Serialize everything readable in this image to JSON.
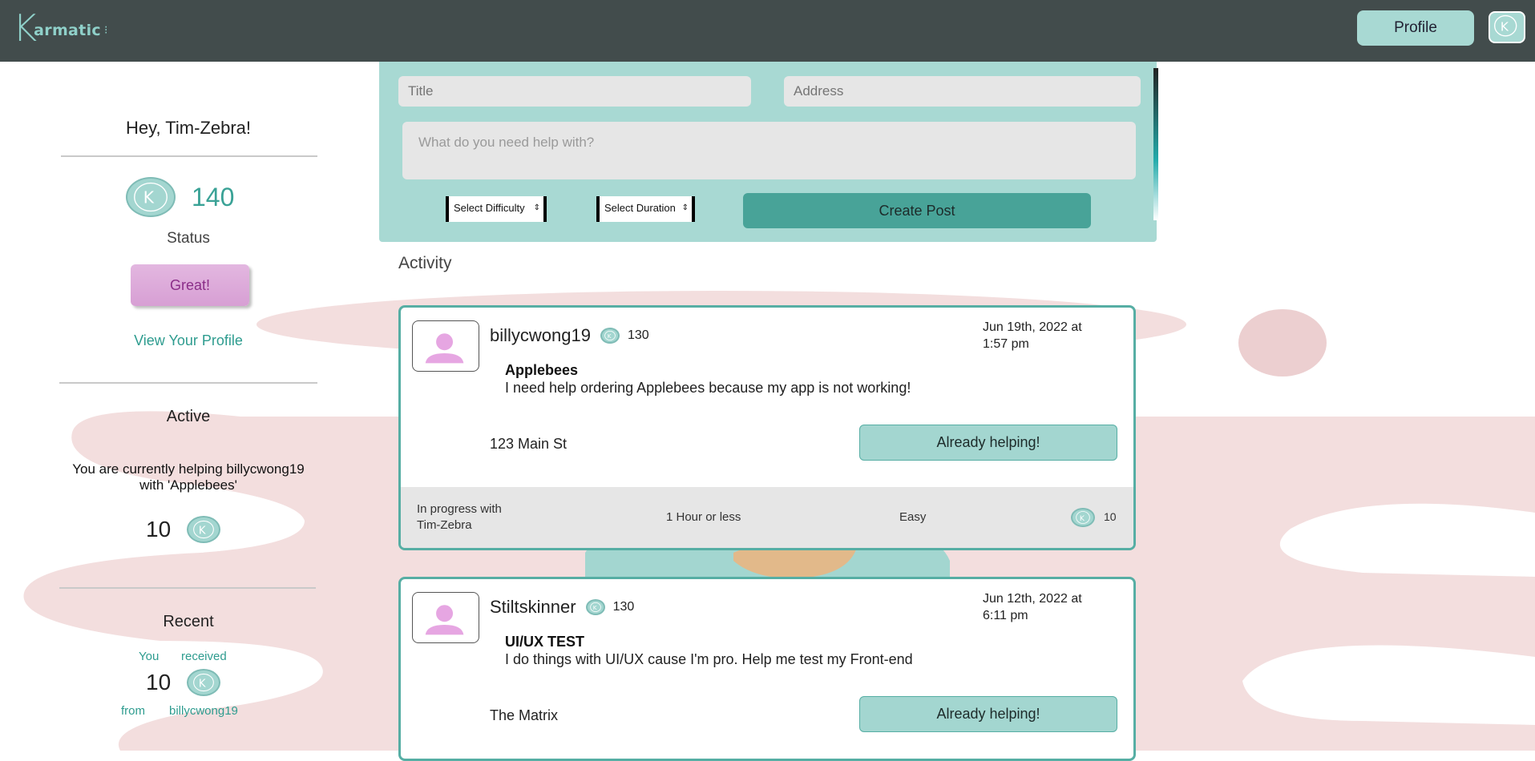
{
  "nav": {
    "logo_text": "armatic",
    "logo_k": "K",
    "profile_label": "Profile"
  },
  "sidebar": {
    "greeting": "Hey, Tim-Zebra!",
    "points": "140",
    "status_label": "Status",
    "status_value": "Great!",
    "view_profile": "View Your Profile",
    "active_title": "Active",
    "helping_line1": "You are currently helping billycwong19",
    "helping_line2": "with 'Applebees'",
    "active_reward": "10",
    "recent_title": "Recent",
    "recent_you": "You",
    "recent_received": "received",
    "recent_amount": "10",
    "recent_from": "from",
    "recent_user": "billycwong19"
  },
  "form": {
    "title_placeholder": "Title",
    "address_placeholder": "Address",
    "details_placeholder": "What do you need help with?",
    "difficulty_select": "Select Difficulty",
    "duration_select": "Select Duration",
    "create_label": "Create Post"
  },
  "activity_label": "Activity",
  "posts": [
    {
      "username": "billycwong19",
      "user_points": "130",
      "date_line1": "Jun 19th, 2022 at",
      "date_line2": "1:57 pm",
      "title": "Applebees",
      "body": "I need help ordering Applebees because my app is not working!",
      "address": "123 Main St",
      "action_label": "Already helping!",
      "footer_status_line1": "In progress with",
      "footer_status_line2": "Tim-Zebra",
      "duration": "1 Hour or less",
      "difficulty": "Easy",
      "reward": "10"
    },
    {
      "username": "Stiltskinner",
      "user_points": "130",
      "date_line1": "Jun 12th, 2022 at",
      "date_line2": "6:11 pm",
      "title": "UI/UX TEST",
      "body": "I do things with UI/UX cause I'm pro. Help me test my Front-end",
      "address": "The Matrix",
      "action_label": "Already helping!"
    }
  ],
  "colors": {
    "navbar": "#424c4c",
    "teal": "#a8d9d3",
    "teal_dark": "#48a398",
    "accent_text": "#2e9c8f",
    "blob_pink": "#f2d8d8"
  }
}
